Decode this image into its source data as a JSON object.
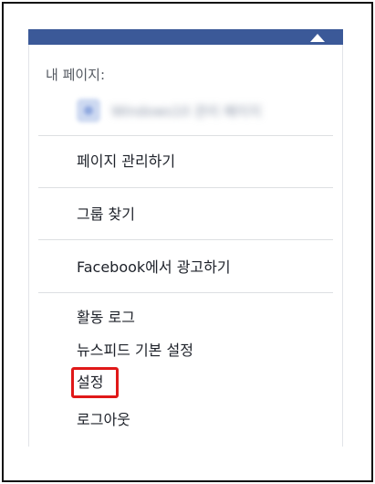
{
  "menu": {
    "my_pages_label": "내 페이지:",
    "page_name": "Windows10 관리 페이지",
    "items": [
      {
        "label": "페이지 관리하기"
      },
      {
        "label": "그룹 찾기"
      },
      {
        "label": "Facebook에서 광고하기"
      },
      {
        "label": "활동 로그"
      },
      {
        "label": "뉴스피드 기본 설정"
      },
      {
        "label": "설정"
      },
      {
        "label": "로그아웃"
      }
    ]
  },
  "colors": {
    "topbar": "#3b5998",
    "highlight": "#e01818",
    "text": "#1d2129"
  },
  "icons": {
    "page_avatar": "page-avatar-icon",
    "caret": "dropdown-caret-icon"
  }
}
